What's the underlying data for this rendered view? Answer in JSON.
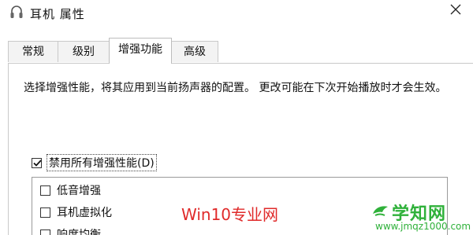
{
  "window": {
    "title": "耳机 属性",
    "close_glyph": "✕"
  },
  "tabs": [
    {
      "label": "常规",
      "active": false
    },
    {
      "label": "级别",
      "active": false
    },
    {
      "label": "增强功能",
      "active": true
    },
    {
      "label": "高级",
      "active": false
    }
  ],
  "enhancements": {
    "description": "选择增强性能，将其应用到当前扬声器的配置。 更改可能在下次开始播放时才会生效。",
    "disable_all_label": "禁用所有增强性能(D)",
    "disable_all_checked": true,
    "items": [
      {
        "label": "低音增强",
        "checked": false
      },
      {
        "label": "耳机虚拟化",
        "checked": false
      },
      {
        "label": "响度均衡",
        "checked": false
      }
    ]
  },
  "watermarks": {
    "center_text": "Win10专业网",
    "logo_text": "学知网",
    "logo_url": "www.jmqz1000.com",
    "center_color": "#e02a2a",
    "logo_color": "#2fb13a"
  }
}
